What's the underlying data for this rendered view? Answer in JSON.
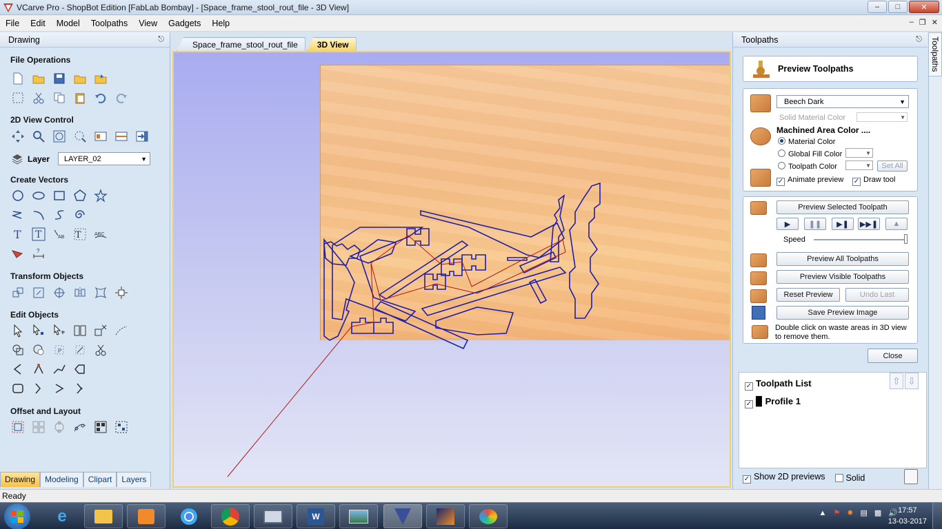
{
  "window": {
    "title": "VCarve Pro - ShopBot Edition [FabLab Bombay] - [Space_frame_stool_rout_file - 3D View]"
  },
  "menu": [
    "File",
    "Edit",
    "Model",
    "Toolpaths",
    "View",
    "Gadgets",
    "Help"
  ],
  "left_panel": {
    "title": "Drawing",
    "sections": {
      "file_operations": "File Operations",
      "view_control": "2D View Control",
      "create_vectors": "Create Vectors",
      "transform_objects": "Transform Objects",
      "edit_objects": "Edit Objects",
      "offset_layout": "Offset and Layout"
    },
    "layer_label": "Layer",
    "layer_value": "LAYER_02",
    "tabs": [
      "Drawing",
      "Modeling",
      "Clipart",
      "Layers"
    ]
  },
  "doc_tabs": [
    "Space_frame_stool_rout_file",
    "3D View"
  ],
  "right_panel": {
    "title": "Toolpaths",
    "side_tab": "Toolpaths",
    "preview_title": "Preview Toolpaths",
    "material": "Beech Dark",
    "solid_material_color": "Solid Material Color",
    "machined_area_color": "Machined Area Color ....",
    "radio_material": "Material Color",
    "radio_global": "Global Fill Color",
    "radio_toolpath": "Toolpath Color",
    "set_all": "Set All",
    "animate_preview": "Animate preview",
    "draw_tool": "Draw tool",
    "preview_selected": "Preview Selected Toolpath",
    "speed": "Speed",
    "preview_all": "Preview All Toolpaths",
    "preview_visible": "Preview Visible Toolpaths",
    "reset_preview": "Reset Preview",
    "undo_last": "Undo Last",
    "save_preview": "Save Preview Image",
    "hint": "Double click on waste areas in 3D view",
    "hint2": "to remove them.",
    "close": "Close",
    "toolpath_list": "Toolpath List",
    "profile": "Profile 1",
    "show_2d": "Show 2D previews",
    "solid": "Solid"
  },
  "status": "Ready",
  "taskbar": {
    "time": "17:57",
    "date": "13-03-2017"
  },
  "colors": {
    "cut_path": "#1e1ea8",
    "rapid_move": "#b01818",
    "material": "#f5be89",
    "accent_tab": "#f6d36b"
  }
}
